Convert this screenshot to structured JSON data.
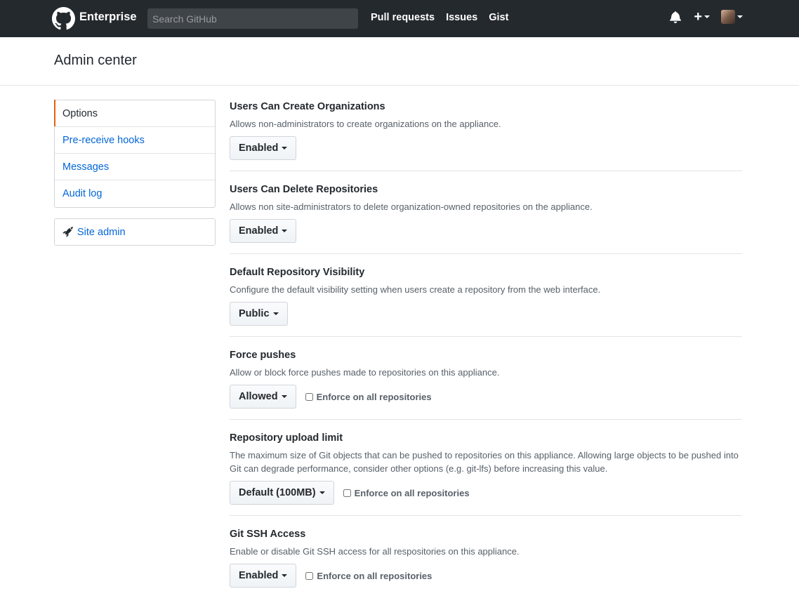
{
  "header": {
    "brand": "Enterprise",
    "search_placeholder": "Search GitHub",
    "nav": [
      "Pull requests",
      "Issues",
      "Gist"
    ],
    "plus_label": "+"
  },
  "page": {
    "title": "Admin center"
  },
  "sidebar": {
    "items": [
      {
        "label": "Options",
        "selected": true
      },
      {
        "label": "Pre-receive hooks",
        "selected": false
      },
      {
        "label": "Messages",
        "selected": false
      },
      {
        "label": "Audit log",
        "selected": false
      }
    ],
    "site_admin": "Site admin"
  },
  "settings": [
    {
      "title": "Users Can Create Organizations",
      "description": "Allows non-administrators to create organizations on the appliance.",
      "value": "Enabled"
    },
    {
      "title": "Users Can Delete Repositories",
      "description": "Allows non site-administrators to delete organization-owned repositories on the appliance.",
      "value": "Enabled"
    },
    {
      "title": "Default Repository Visibility",
      "description": "Configure the default visibility setting when users create a repository from the web interface.",
      "value": "Public"
    },
    {
      "title": "Force pushes",
      "description": "Allow or block force pushes made to repositories on this appliance.",
      "value": "Allowed",
      "enforce": "Enforce on all repositories"
    },
    {
      "title": "Repository upload limit",
      "description": "The maximum size of Git objects that can be pushed to repositories on this appliance. Allowing large objects to be pushed into Git can degrade performance, consider other options (e.g. git-lfs) before increasing this value.",
      "value": "Default (100MB)",
      "enforce": "Enforce on all repositories"
    },
    {
      "title": "Git SSH Access",
      "description": "Enable or disable Git SSH access for all respositories on this appliance.",
      "value": "Enabled",
      "enforce": "Enforce on all repositories"
    }
  ],
  "colors": {
    "header_bg": "#24292e",
    "link": "#0366d6",
    "selected_accent": "#e36209"
  }
}
